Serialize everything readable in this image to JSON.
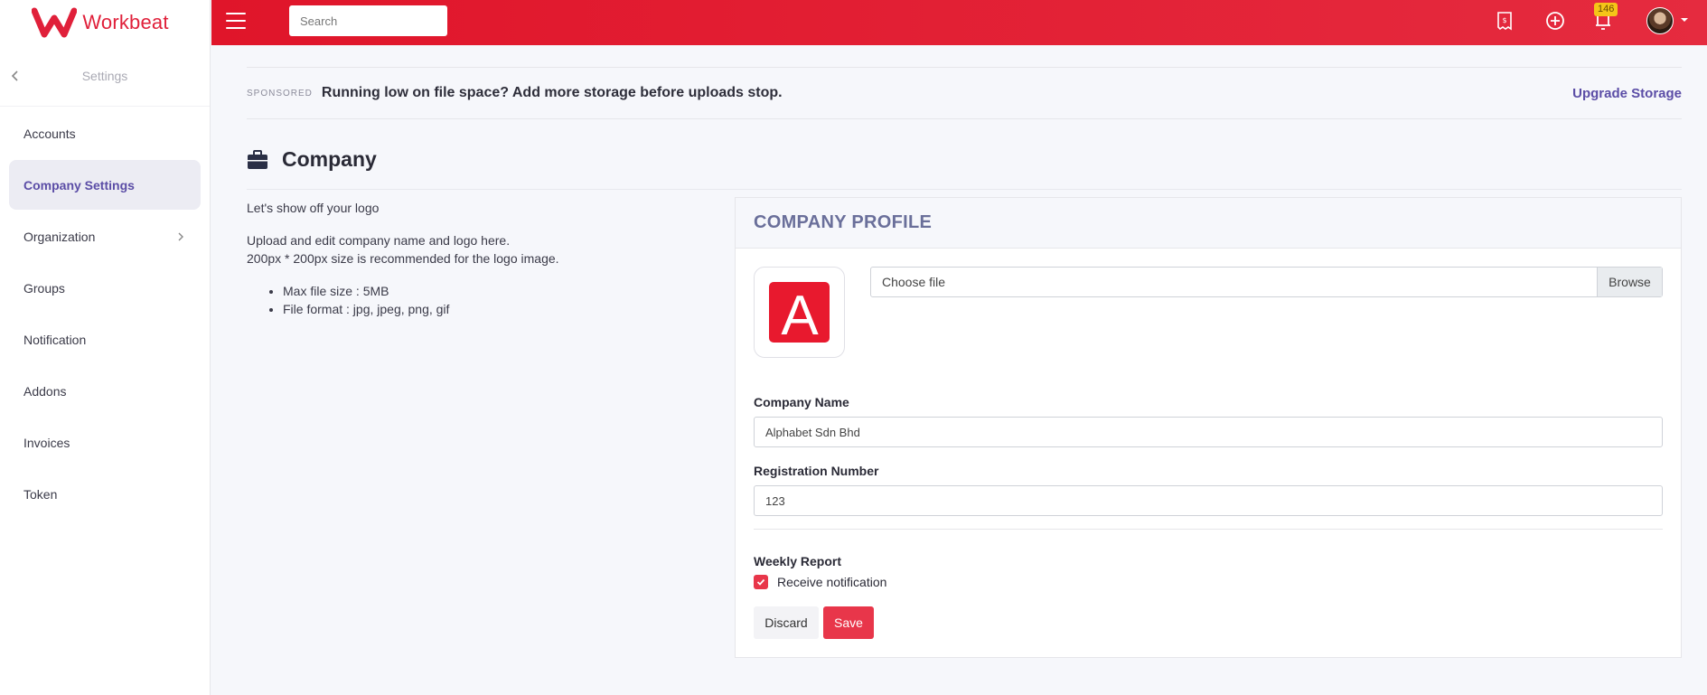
{
  "app": {
    "name": "Workbeat",
    "brand_color": "#e0203a"
  },
  "sidebar": {
    "title": "Settings",
    "items": [
      {
        "label": "Accounts",
        "active": false
      },
      {
        "label": "Company Settings",
        "active": true
      },
      {
        "label": "Organization",
        "active": false,
        "has_submenu": true
      },
      {
        "label": "Groups",
        "active": false
      },
      {
        "label": "Notification",
        "active": false
      },
      {
        "label": "Addons",
        "active": false
      },
      {
        "label": "Invoices",
        "active": false
      },
      {
        "label": "Token",
        "active": false
      }
    ]
  },
  "topbar": {
    "search_placeholder": "Search",
    "icons": [
      "menu-icon",
      "receipt-icon",
      "add-circle-icon",
      "notification-icon",
      "avatar"
    ],
    "notification_count": "146"
  },
  "banner": {
    "tag": "SPONSORED",
    "text": "Running low on file space? Add more storage before uploads stop.",
    "link": "Upgrade Storage"
  },
  "page": {
    "title": "Company"
  },
  "info": {
    "intro": "Let's show off your logo",
    "line1": "Upload and edit company name and logo here.",
    "line2": "200px * 200px size is recommended for the logo image.",
    "bullets": [
      "Max file size : 5MB",
      "File format : jpg, jpeg, png, gif"
    ]
  },
  "profile": {
    "title": "COMPANY PROFILE",
    "logo_letter": "A",
    "file_label": "Choose file",
    "browse_label": "Browse",
    "company_name_label": "Company Name",
    "company_name_value": "Alphabet Sdn Bhd",
    "reg_number_label": "Registration Number",
    "reg_number_value": "123",
    "weekly_report_label": "Weekly Report",
    "receive_notification_label": "Receive notification",
    "receive_notification_checked": true,
    "discard_label": "Discard",
    "save_label": "Save"
  },
  "colors": {
    "topbar": "#e0152a",
    "accent": "#5b4da6",
    "save": "#e8364a",
    "badge": "#f5c518"
  }
}
